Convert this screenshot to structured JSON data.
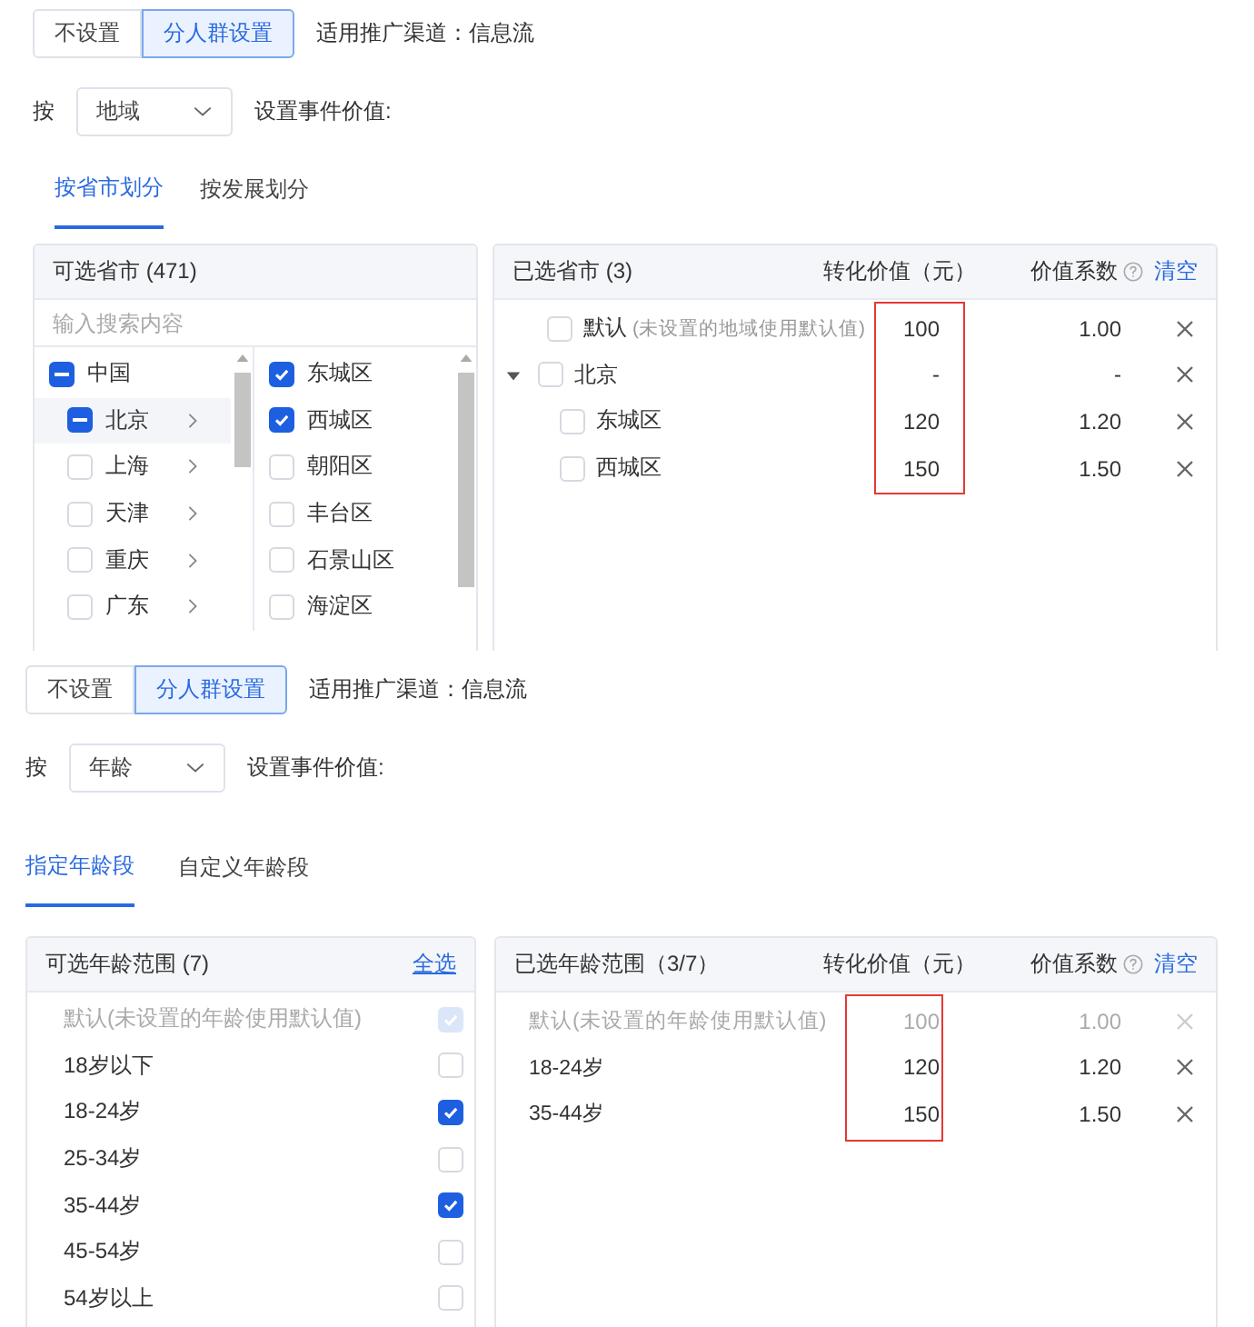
{
  "sections": [
    {
      "kind": "region",
      "mode_buttons": [
        {
          "label": "不设置",
          "selected": false
        },
        {
          "label": "分人群设置",
          "selected": true
        }
      ],
      "channel_text": "适用推广渠道：信息流",
      "by_label": "按",
      "dimension_select": {
        "value": "地域"
      },
      "event_value_label": "设置事件价值:",
      "tabs": [
        {
          "label": "按省市划分",
          "selected": true
        },
        {
          "label": "按发展划分",
          "selected": false
        }
      ],
      "available": {
        "title": "可选省市 (471)",
        "search": {
          "placeholder": "输入搜索内容"
        },
        "provinces": [
          {
            "label": "中国",
            "checked": false,
            "indeterminate": true,
            "selected": false,
            "children": [
              {
                "label": "北京",
                "checked": false,
                "indeterminate": true,
                "selected": true
              },
              {
                "label": "上海",
                "checked": false,
                "indeterminate": false,
                "selected": false
              },
              {
                "label": "天津",
                "checked": false,
                "indeterminate": false,
                "selected": false
              },
              {
                "label": "重庆",
                "checked": false,
                "indeterminate": false,
                "selected": false
              },
              {
                "label": "广东",
                "checked": false,
                "indeterminate": false,
                "selected": false
              }
            ]
          }
        ],
        "districts": [
          {
            "label": "东城区",
            "checked": true
          },
          {
            "label": "西城区",
            "checked": true
          },
          {
            "label": "朝阳区",
            "checked": false
          },
          {
            "label": "丰台区",
            "checked": false
          },
          {
            "label": "石景山区",
            "checked": false
          },
          {
            "label": "海淀区",
            "checked": false
          }
        ]
      },
      "chosen": {
        "title": "已选省市 (3)",
        "value_header": "转化价值（元）",
        "coef_header": "价值系数",
        "clear_link": "清空",
        "value_column_highlighted": true,
        "rows": [
          {
            "label": "默认",
            "note": "(未设置的地域使用默认值)",
            "value": "100",
            "coef": "1.00",
            "checked": false
          },
          {
            "label": "北京",
            "value": "-",
            "coef": "-",
            "checked": false,
            "expanded": true,
            "children": [
              {
                "label": "东城区",
                "value": "120",
                "coef": "1.20",
                "checked": false
              },
              {
                "label": "西城区",
                "value": "150",
                "coef": "1.50",
                "checked": false
              }
            ]
          }
        ]
      }
    },
    {
      "kind": "age",
      "mode_buttons": [
        {
          "label": "不设置",
          "selected": false
        },
        {
          "label": "分人群设置",
          "selected": true
        }
      ],
      "channel_text": "适用推广渠道：信息流",
      "by_label": "按",
      "dimension_select": {
        "value": "年龄"
      },
      "event_value_label": "设置事件价值:",
      "tabs": [
        {
          "label": "指定年龄段",
          "selected": true
        },
        {
          "label": "自定义年龄段",
          "selected": false
        }
      ],
      "available": {
        "title": "可选年龄范围 (7)",
        "select_all_link": "全选",
        "items": [
          {
            "label": "默认(未设置的年龄使用默认值)",
            "checked": true,
            "disabled": true
          },
          {
            "label": "18岁以下",
            "checked": false,
            "disabled": false
          },
          {
            "label": "18-24岁",
            "checked": true,
            "disabled": false
          },
          {
            "label": "25-34岁",
            "checked": false,
            "disabled": false
          },
          {
            "label": "35-44岁",
            "checked": true,
            "disabled": false
          },
          {
            "label": "45-54岁",
            "checked": false,
            "disabled": false
          },
          {
            "label": "54岁以上",
            "checked": false,
            "disabled": false
          }
        ]
      },
      "chosen": {
        "title": "已选年龄范围（3/7）",
        "value_header": "转化价值（元）",
        "coef_header": "价值系数",
        "clear_link": "清空",
        "value_column_highlighted": true,
        "rows": [
          {
            "label": "默认(未设置的年龄使用默认值)",
            "value": "100",
            "coef": "1.00",
            "disabled": true
          },
          {
            "label": "18-24岁",
            "value": "120",
            "coef": "1.20",
            "disabled": false
          },
          {
            "label": "35-44岁",
            "value": "150",
            "coef": "1.50",
            "disabled": false
          }
        ]
      }
    }
  ]
}
